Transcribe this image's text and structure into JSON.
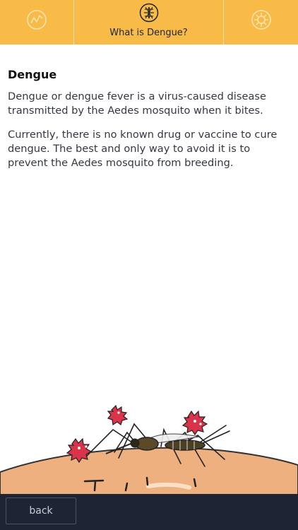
{
  "tabs": {
    "left": {
      "icon": "trend-line-icon"
    },
    "middle": {
      "icon": "mosquito-icon",
      "label": "What is Dengue?"
    },
    "right": {
      "icon": "virus-icon"
    }
  },
  "content": {
    "heading": "Dengue",
    "paragraph_1": "Dengue or dengue fever is a virus-caused disease transmitted by the Aedes mosquito when it bites.",
    "paragraph_2": "Currently, there is no known drug or vaccine to cure dengue. The best and only way to avoid it is to prevent the Aedes mosquito from breeding."
  },
  "illustration": {
    "subject": "mosquito-biting-skin-with-virus-particles"
  },
  "footer": {
    "back_label": "back"
  },
  "colors": {
    "tab_bar": "#f8bb48",
    "footer": "#1e2434",
    "skin": "#eeb07e",
    "virus": "#d9344a"
  }
}
